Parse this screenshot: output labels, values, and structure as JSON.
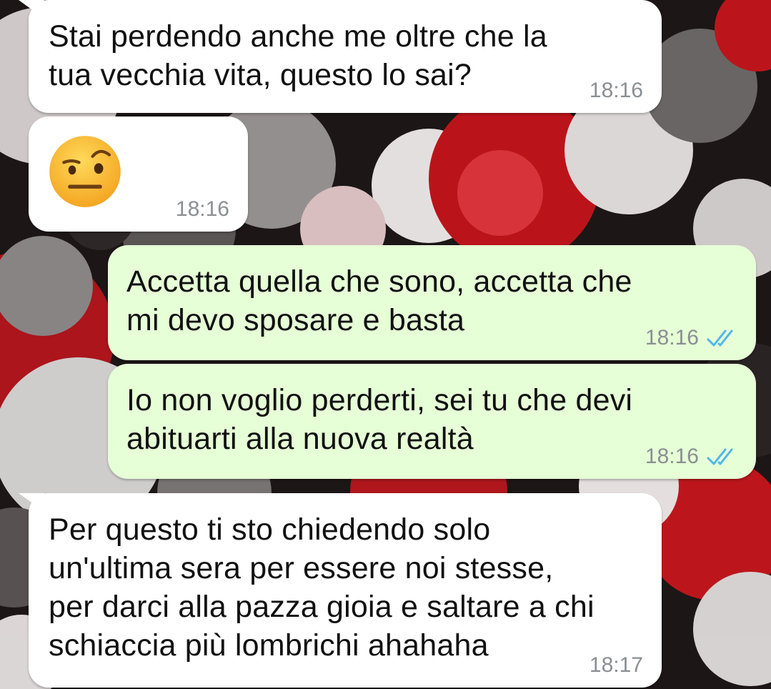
{
  "colors": {
    "incoming_bubble": "#ffffff",
    "outgoing_bubble": "#e6ffd6",
    "text": "#111111",
    "timestamp": "#8a8f93",
    "read_ticks": "#4fb6ec"
  },
  "messages": [
    {
      "direction": "incoming",
      "text": "Stai perdendo anche me oltre che la\ntua vecchia vita, questo lo sai?",
      "time": "18:16"
    },
    {
      "direction": "incoming",
      "emoji": "face-with-raised-eyebrow",
      "time": "18:16"
    },
    {
      "direction": "outgoing",
      "text": "Accetta quella che sono, accetta che\nmi devo sposare e basta",
      "time": "18:16",
      "status": "read"
    },
    {
      "direction": "outgoing",
      "text": "Io non voglio perderti, sei tu che devi\nabituarti alla nuova realtà",
      "time": "18:16",
      "status": "read"
    },
    {
      "direction": "incoming",
      "text": "Per questo ti sto chiedendo solo\nun'ultima sera per essere noi stesse,\nper darci alla pazza gioia e saltare a chi\nschiaccia più lombrichi ahahaha",
      "time": "18:17"
    }
  ]
}
